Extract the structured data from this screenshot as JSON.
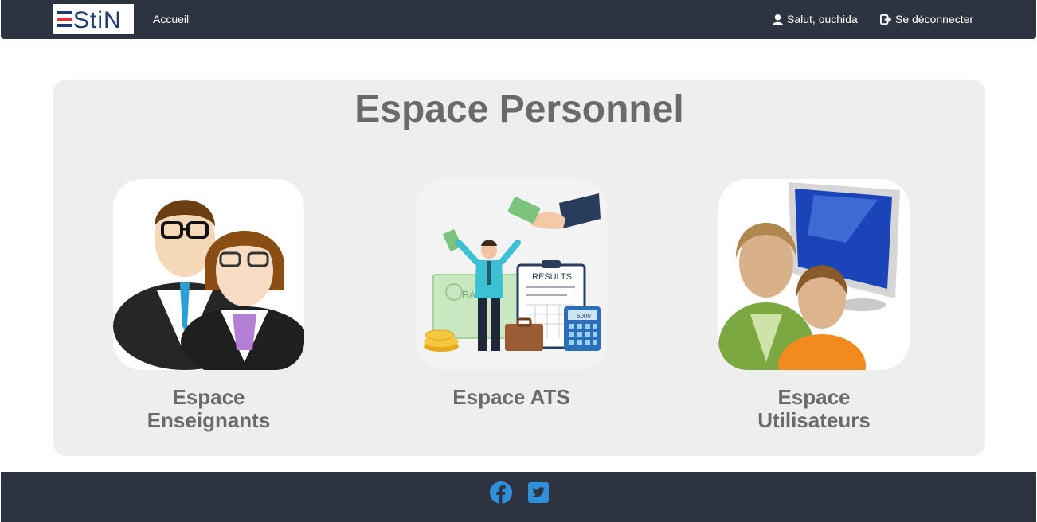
{
  "navbar": {
    "logo_text": "EStiN",
    "home_label": "Accueil",
    "user_label": "Salut, ouchida",
    "logout_label": "Se déconnecter",
    "background": "#2e3341"
  },
  "main": {
    "title": "Espace Personnel",
    "cards": [
      {
        "label_line1": "Espace",
        "label_line2": "Enseignants",
        "icon": "teachers-illustration"
      },
      {
        "label_line1": "Espace ATS",
        "label_line2": "",
        "icon": "ats-finance-illustration"
      },
      {
        "label_line1": "Espace",
        "label_line2": "Utilisateurs",
        "icon": "users-computer-illustration"
      }
    ],
    "results_text": "RESULTS",
    "calculator_value": "6000",
    "bank_text": "BAN"
  },
  "footer": {
    "social": [
      "facebook-icon",
      "twitter-icon"
    ],
    "accent": "#2f8fd8"
  }
}
